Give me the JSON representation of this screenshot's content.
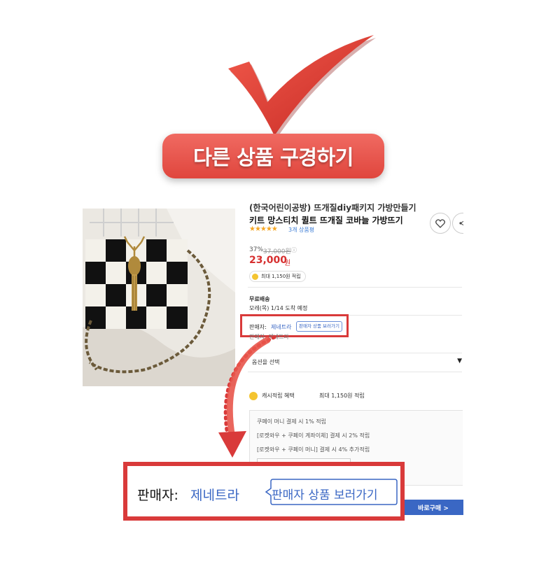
{
  "header": {
    "title": "다른 상품 구경하기"
  },
  "product": {
    "title_cut": "(한국어린이공방) 뜨개질diy패키지 가방만들기",
    "name": "키트 망스티치 퀼트 뜨개질 코바늘 가방뜨기",
    "rating_stars": "★★★★★",
    "review_count": "3개 상품평",
    "discount": "37%",
    "original_price": "37,000원",
    "price": "23,000",
    "price_unit": "원",
    "point_badge": "최대 1,150원 적립",
    "shipping_label": "무료배송",
    "shipping_date": "모레(목) 1/14 도착 예정",
    "seller_label": "판매자:",
    "seller_name": "제네트라",
    "seller_button": "판매자 상품 보러가기",
    "seller_cut": "판매자: 제네트라",
    "option_label": "옵션을 선택",
    "cash_label": "캐시적립 혜택",
    "cash_max": "최대 1,150원 적립",
    "benefits": [
      "쿠페이 머니 결제 시 1% 적립",
      "[로켓와우 + 쿠페이 계좌이체] 결제 시 2% 적립",
      "[로켓와우 + 쿠페이 머니] 결제 시 4% 추가적립"
    ],
    "buy_now": "바로구매 >"
  },
  "zoom": {
    "seller_label": "판매자:",
    "seller_name": "제네트라",
    "seller_button": "판매자 상품 보러가기"
  },
  "colors": {
    "accent_red": "#d93a3a",
    "link_blue": "#3a67c4",
    "price_red": "#d62f2f"
  }
}
